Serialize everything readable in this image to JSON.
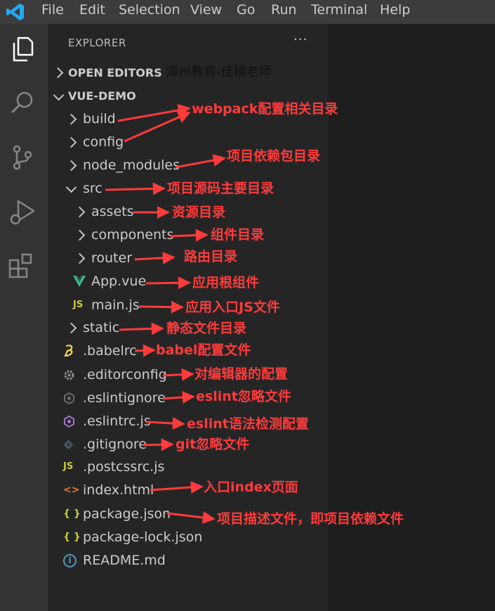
{
  "menu": [
    "File",
    "Edit",
    "Selection",
    "View",
    "Go",
    "Run",
    "Terminal",
    "Help"
  ],
  "activity_icons": [
    "explorer-icon",
    "search-icon",
    "source-control-icon",
    "run-debug-icon",
    "extensions-icon"
  ],
  "sidebar": {
    "header": "EXPLORER",
    "more": "···",
    "open_editors": "OPEN EDITORS",
    "project": "VUE-DEMO"
  },
  "watermark": "漳州教育-佳楠老师",
  "tree": [
    {
      "name": "build",
      "kind": "folder",
      "icon": "chevron-right"
    },
    {
      "name": "config",
      "kind": "folder",
      "icon": "chevron-right"
    },
    {
      "name": "node_modules",
      "kind": "folder",
      "icon": "chevron-right"
    },
    {
      "name": "src",
      "kind": "folder",
      "icon": "chevron-down"
    },
    {
      "name": "assets",
      "kind": "folder",
      "icon": "chevron-right"
    },
    {
      "name": "components",
      "kind": "folder",
      "icon": "chevron-right"
    },
    {
      "name": "router",
      "kind": "folder",
      "icon": "chevron-right"
    },
    {
      "name": "App.vue",
      "kind": "file",
      "icon": "vue-icon"
    },
    {
      "name": "main.js",
      "kind": "file",
      "icon": "js-icon"
    },
    {
      "name": "static",
      "kind": "folder",
      "icon": "chevron-right"
    },
    {
      "name": ".babelrc",
      "kind": "file",
      "icon": "babel-icon"
    },
    {
      "name": ".editorconfig",
      "kind": "file",
      "icon": "gear-icon"
    },
    {
      "name": ".eslintignore",
      "kind": "file",
      "icon": "eslint-ignore-icon"
    },
    {
      "name": ".eslintrc.js",
      "kind": "file",
      "icon": "eslint-icon"
    },
    {
      "name": ".gitignore",
      "kind": "file",
      "icon": "git-icon"
    },
    {
      "name": ".postcssrc.js",
      "kind": "file",
      "icon": "js-icon"
    },
    {
      "name": "index.html",
      "kind": "file",
      "icon": "html-icon"
    },
    {
      "name": "package.json",
      "kind": "file",
      "icon": "json-icon"
    },
    {
      "name": "package-lock.json",
      "kind": "file",
      "icon": "json-icon"
    },
    {
      "name": "README.md",
      "kind": "file",
      "icon": "info-icon"
    }
  ],
  "icon_glyphs": {
    "js": "JS",
    "json": "{ }",
    "html": "<>",
    "info": "i"
  },
  "annotations": [
    "webpack配置相关目录",
    "项目依赖包目录",
    "项目源码主要目录",
    "资源目录",
    "组件目录",
    "路由目录",
    "应用根组件",
    "应用入口JS文件",
    "静态文件目录",
    "babel配置文件",
    "对编辑器的配置",
    "eslint忽略文件",
    "eslint语法检测配置",
    "git忽略文件",
    "入口index页面",
    "项目描述文件，即项目依赖文件"
  ],
  "colors": {
    "menubar": "#3c3c3c",
    "activitybar": "#333333",
    "sidebar": "#252526",
    "editor": "#1e1e1e",
    "annotation": "#ff3b3b",
    "vscode_blue": "#23a9f2"
  }
}
